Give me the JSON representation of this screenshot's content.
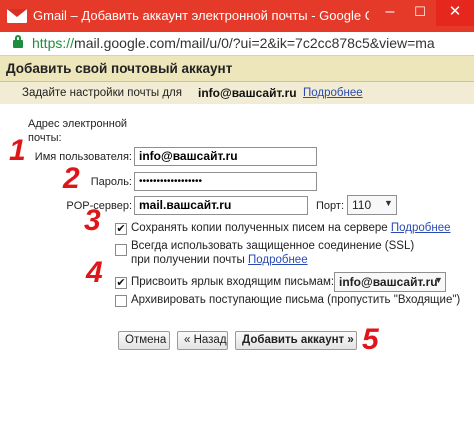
{
  "window": {
    "title": "Gmail – Добавить аккаунт электронной почты - Google Chro",
    "minimize_glyph": "–",
    "maximize_glyph": "☐",
    "close_glyph": "✕"
  },
  "address_bar": {
    "url_scheme": "https://",
    "url_rest": "mail.google.com/mail/u/0/?ui=2&ik=7c2cc878c5&view=ma"
  },
  "page": {
    "title": "Добавить свой почтовый аккаунт",
    "subheader": {
      "label": "Задайте настройки почты для",
      "email": "info@вашсайт.ru",
      "more_link": "Подробнее"
    }
  },
  "form": {
    "address_label": "Адрес электронной почты:",
    "username_label": "Имя пользователя:",
    "username_value": "info@вашсайт.ru",
    "password_label": "Пароль:",
    "password_value": "••••••••••••••••••",
    "pop_label": "POP-сервер:",
    "pop_value": "mail.вашсайт.ru",
    "port_label": "Порт:",
    "port_value": "110",
    "options": [
      {
        "label": "Сохранять копии полученных писем на сервере",
        "link": "Подробнее",
        "checked": true
      },
      {
        "label": "Всегда использовать защищенное соединение (SSL) при получении почты",
        "link": "Подробнее",
        "checked": false
      },
      {
        "label": "Присвоить ярлык входящим письмам:",
        "checked": true
      },
      {
        "label": "Архивировать поступающие письма (пропустить \"Входящие\")",
        "checked": false
      }
    ],
    "label_select_value": "info@вашсайт.ru",
    "checkmark": "✔",
    "caret": "▼"
  },
  "buttons": {
    "cancel": "Отмена",
    "back": "« Назад",
    "add": "Добавить аккаунт »"
  },
  "markers": [
    "1",
    "2",
    "3",
    "4",
    "5"
  ],
  "colors": {
    "titlebar": "#e53a29",
    "header_band": "#ede6bb",
    "link": "#2a4ab3",
    "marker": "#e0151a"
  }
}
